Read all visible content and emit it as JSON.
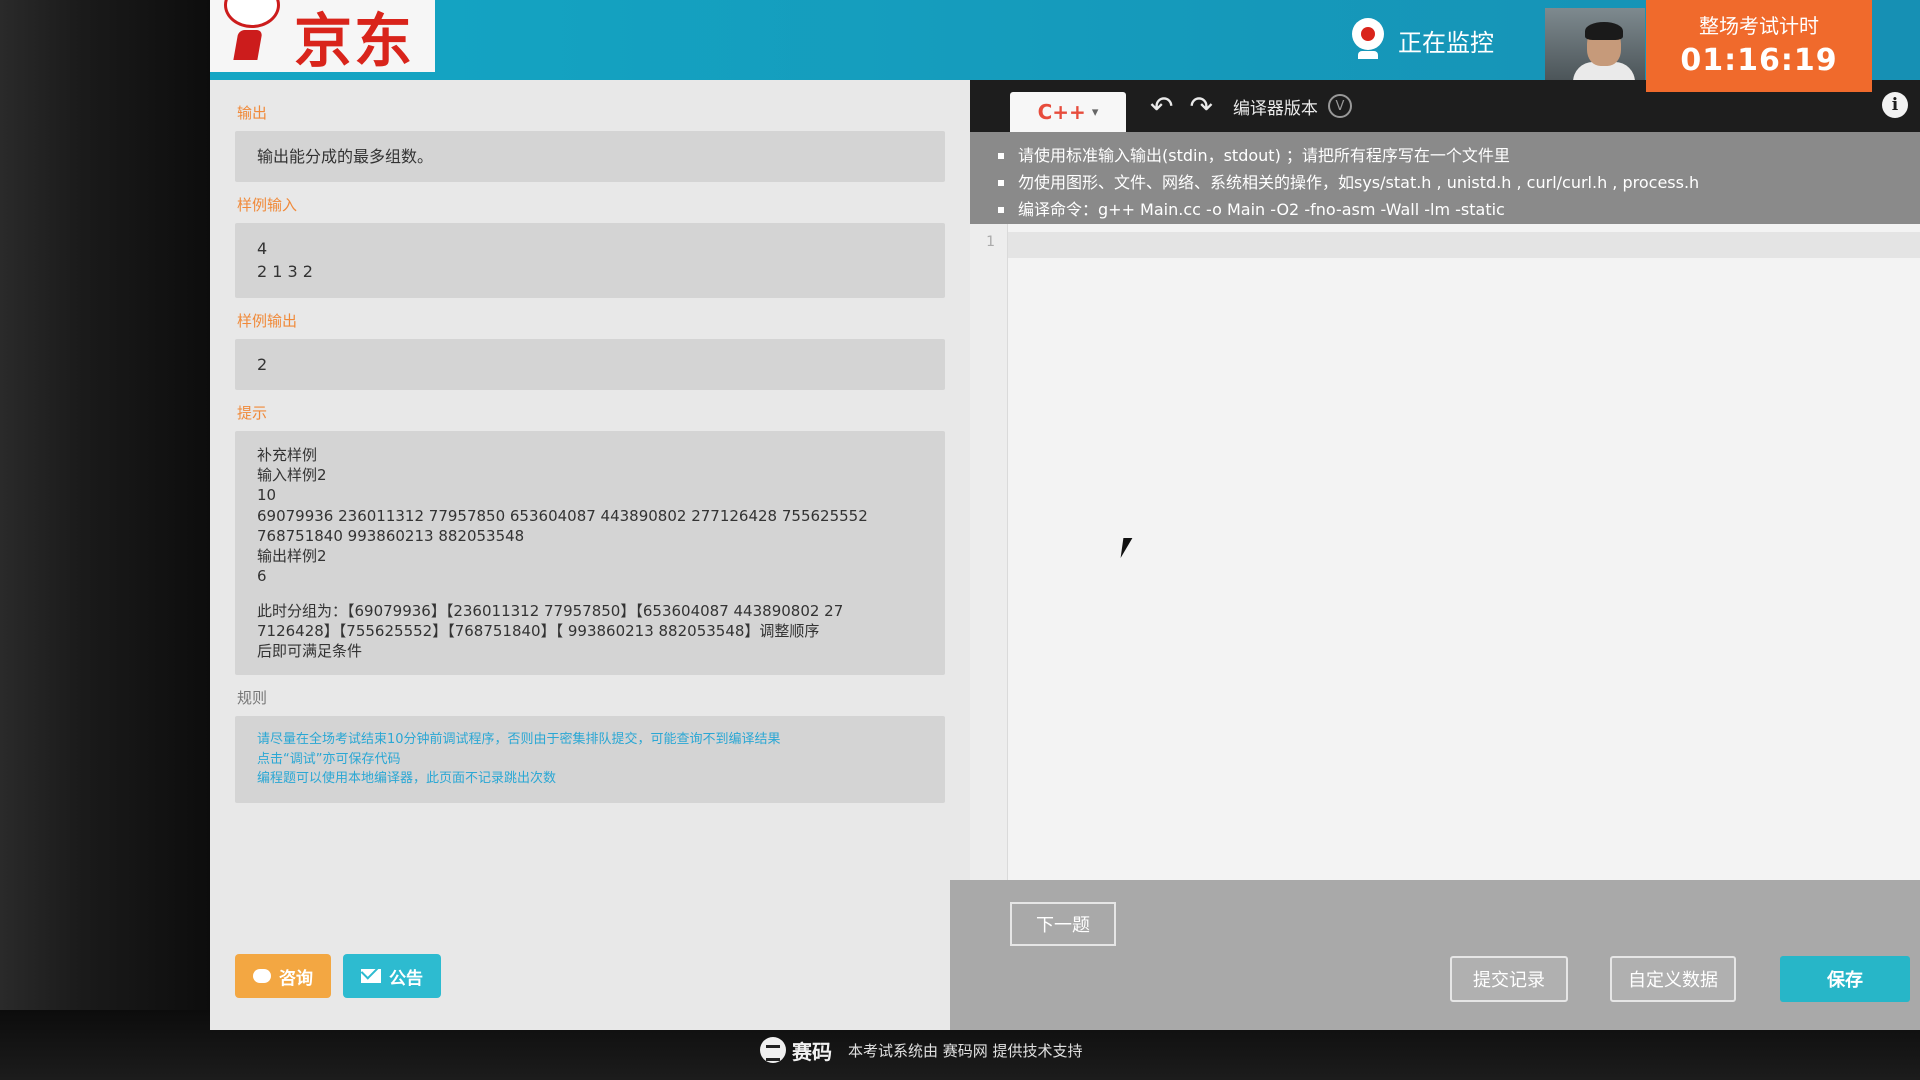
{
  "header": {
    "brand": "京东",
    "monitor_text": "正在监控",
    "timer_label": "整场考试计时",
    "timer_value": "01:16:19"
  },
  "problem": {
    "output_title": "输出",
    "output_desc": "输出能分成的最多组数。",
    "sample_input_title": "样例输入",
    "sample_input_lines": [
      "4",
      "2 1 3 2"
    ],
    "sample_output_title": "样例输出",
    "sample_output_lines": [
      "2"
    ],
    "hint_title": "提示",
    "hint_lines": [
      "补充样例",
      "输入样例2",
      "10",
      "69079936 236011312 77957850 653604087 443890802 277126428 755625552",
      "768751840 993860213 882053548",
      "输出样例2",
      "6",
      "",
      "此时分组为：【69079936】【236011312 77957850】【653604087 443890802 27",
      "7126428】【755625552】【768751840】【 993860213 882053548】调整顺序",
      "后即可满足条件"
    ],
    "rules_title": "规则",
    "rules_lines": [
      "请尽量在全场考试结束10分钟前调试程序，否则由于密集排队提交，可能查询不到编译结果",
      "点击“调试”亦可保存代码",
      "编程题可以使用本地编译器，此页面不记录跳出次数"
    ]
  },
  "left_buttons": {
    "consult": "咨询",
    "notice": "公告"
  },
  "editor": {
    "language": "C++",
    "compiler_label": "编译器版本",
    "version_icon_text": "V",
    "notices": [
      "请使用标准输入输出(stdin，stdout) ；请把所有程序写在一个文件里",
      "勿使用图形、文件、网络、系统相关的操作，如sys/stat.h , unistd.h , curl/curl.h , process.h",
      "编译命令：g++ Main.cc -o Main -O2 -fno-asm -Wall -lm -static"
    ],
    "line_number": "1",
    "next_button": "下一题",
    "submit_record": "提交记录",
    "custom_data": "自定义数据",
    "save": "保存"
  },
  "footer": {
    "logo_text": "赛码",
    "support_text": "本考试系统由 赛码网 提供技术支持"
  },
  "icons": {
    "monitor": "webcam-icon",
    "undo": "undo-icon",
    "redo": "redo-icon",
    "info": "info-icon",
    "consult": "chat-icon",
    "notice": "mail-icon"
  },
  "colors": {
    "header_teal": "#14a6c4",
    "timer_orange": "#f06a2c",
    "brand_red": "#d9241b",
    "section_orange": "#f08a3a",
    "save_teal": "#27b6c8"
  }
}
